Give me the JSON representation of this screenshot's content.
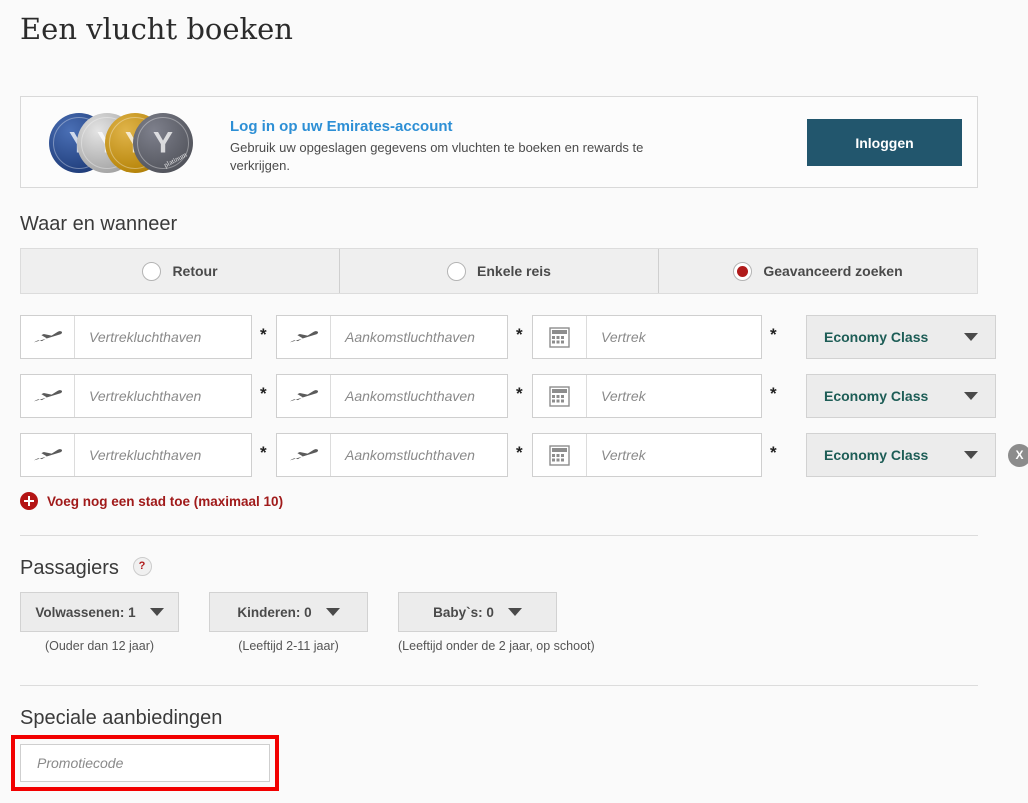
{
  "page": {
    "title": "Een vlucht boeken"
  },
  "login_banner": {
    "link_text": "Log in op uw Emirates-account",
    "description": "Gebruik uw opgeslagen gegevens om vluchten te boeken en rewards te verkrijgen.",
    "button_label": "Inloggen",
    "button_color": "#22566d",
    "link_color": "#2d8fd5",
    "medallions": [
      {
        "name": "coin-blue",
        "tier": "blue"
      },
      {
        "name": "coin-silver",
        "tier": "silver"
      },
      {
        "name": "coin-gold",
        "tier": "gold"
      },
      {
        "name": "coin-platinum",
        "tier": "platinum"
      }
    ]
  },
  "where_when": {
    "heading": "Waar en wanneer",
    "trip_types": [
      {
        "label": "Retour",
        "checked": false
      },
      {
        "label": "Enkele reis",
        "checked": false
      },
      {
        "label": "Geavanceerd zoeken",
        "checked": true
      }
    ],
    "selected_color": "#b01b1b",
    "required_marker": "*",
    "flight_rows": [
      {
        "origin_placeholder": "Vertrekluchthaven",
        "origin_value": "",
        "destination_placeholder": "Aankomstluchthaven",
        "destination_value": "",
        "date_placeholder": "Vertrek",
        "date_value": "",
        "cabin_class": "Economy Class",
        "removable": false
      },
      {
        "origin_placeholder": "Vertrekluchthaven",
        "origin_value": "",
        "destination_placeholder": "Aankomstluchthaven",
        "destination_value": "",
        "date_placeholder": "Vertrek",
        "date_value": "",
        "cabin_class": "Economy Class",
        "removable": false
      },
      {
        "origin_placeholder": "Vertrekluchthaven",
        "origin_value": "",
        "destination_placeholder": "Aankomstluchthaven",
        "destination_value": "",
        "date_placeholder": "Vertrek",
        "date_value": "",
        "cabin_class": "Economy Class",
        "removable": true,
        "remove_label": "X"
      }
    ],
    "add_city_label": "Voeg nog een stad toe (maximaal 10)",
    "add_city_color": "#a01a1a"
  },
  "passengers": {
    "heading": "Passagiers",
    "help_icon_label": "?",
    "groups": [
      {
        "label": "Volwassenen: 1",
        "note": "(Ouder dan 12 jaar)"
      },
      {
        "label": "Kinderen: 0",
        "note": "(Leeftijd 2-11 jaar)"
      },
      {
        "label": "Baby`s: 0",
        "note": "(Leeftijd onder de 2 jaar, op schoot)"
      }
    ]
  },
  "special_offers": {
    "heading": "Speciale aanbiedingen",
    "promo_placeholder": "Promotiecode",
    "promo_value": "",
    "highlight_color": "#f20000"
  }
}
